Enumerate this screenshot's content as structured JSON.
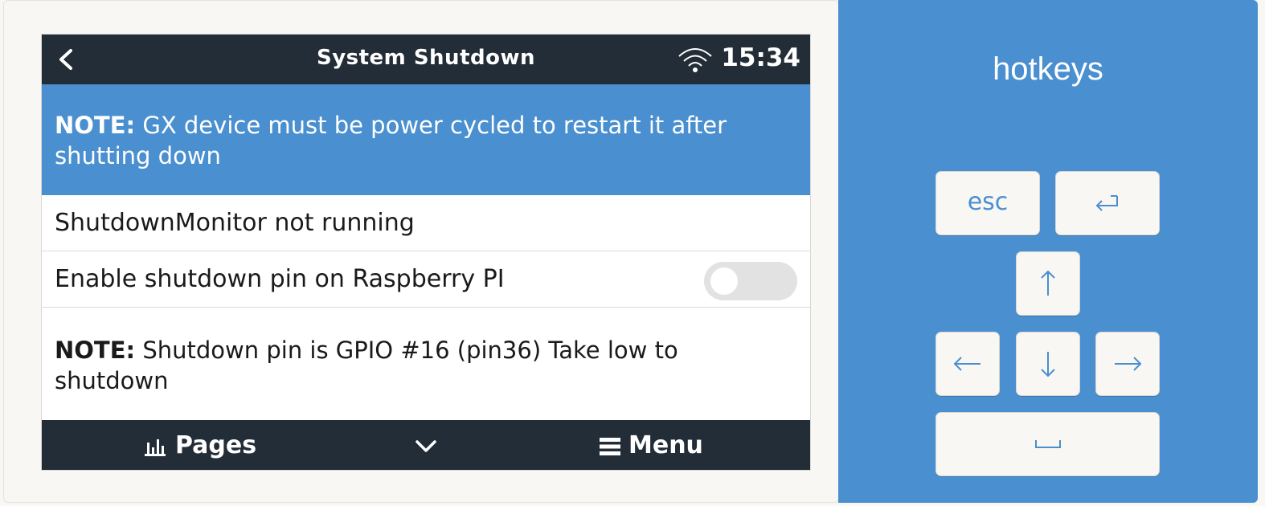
{
  "screen": {
    "title": "System Shutdown",
    "clock": "15:34",
    "icons": [
      "back-icon",
      "wifi-icon"
    ],
    "note_banner": {
      "label": "NOTE:",
      "text": " GX device must be power cycled to restart it after shutting down"
    },
    "rows": [
      {
        "label": "ShutdownMonitor not running"
      },
      {
        "label": "Enable shutdown pin on Raspberry PI",
        "toggle_on": false
      }
    ],
    "note_pin": {
      "label": "NOTE:",
      "text": " Shutdown pin is GPIO #16 (pin36) Take low to shutdown"
    },
    "bottom_bar": {
      "pages_label": "Pages",
      "menu_label": "Menu",
      "icons": [
        "pages-icon",
        "chevron-down-icon",
        "menu-icon"
      ]
    }
  },
  "hotkeys": {
    "title": "hotkeys",
    "keys": [
      {
        "name": "esc",
        "label": "esc"
      },
      {
        "name": "enter",
        "icon": "enter-icon"
      },
      {
        "name": "up",
        "icon": "arrow-up-icon"
      },
      {
        "name": "left",
        "icon": "arrow-left-icon"
      },
      {
        "name": "down",
        "icon": "arrow-down-icon"
      },
      {
        "name": "right",
        "icon": "arrow-right-icon"
      },
      {
        "name": "space",
        "icon": "space-icon"
      }
    ]
  },
  "colors": {
    "accent_blue": "#4a8fcf",
    "dark_bar": "#222d38",
    "panel_bg": "#f8f7f4"
  }
}
